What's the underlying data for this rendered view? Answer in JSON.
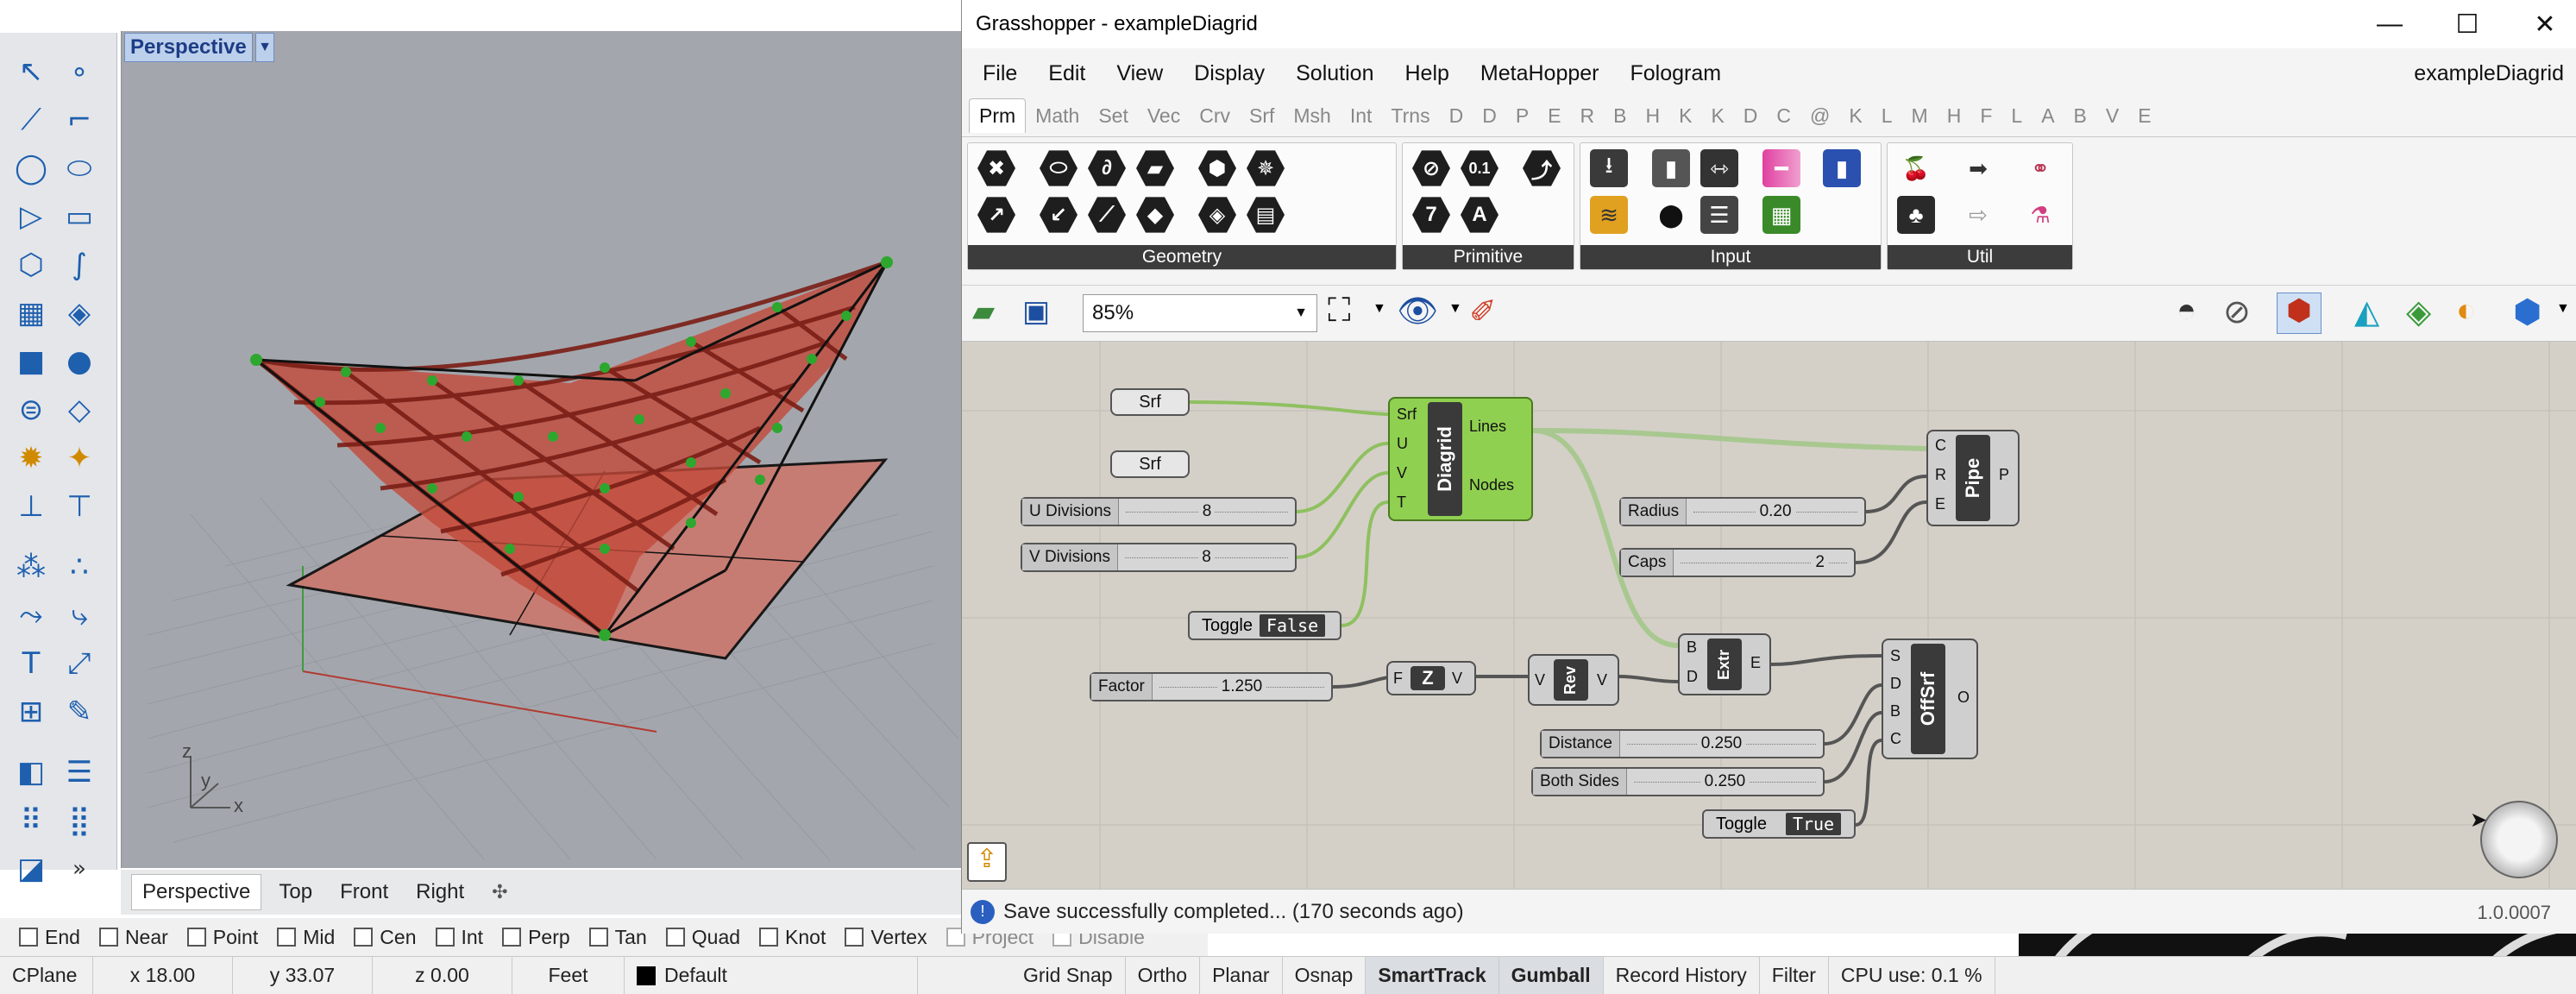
{
  "rhino": {
    "viewport_title": "Perspective",
    "axis_labels": {
      "z": "z",
      "y": "y",
      "x": "x"
    },
    "viewport_tabs": [
      "Perspective",
      "Top",
      "Front",
      "Right"
    ],
    "osnaps": [
      {
        "label": "End",
        "checked": false,
        "enabled": true
      },
      {
        "label": "Near",
        "checked": false,
        "enabled": true
      },
      {
        "label": "Point",
        "checked": false,
        "enabled": true
      },
      {
        "label": "Mid",
        "checked": false,
        "enabled": true
      },
      {
        "label": "Cen",
        "checked": false,
        "enabled": true
      },
      {
        "label": "Int",
        "checked": false,
        "enabled": true
      },
      {
        "label": "Perp",
        "checked": false,
        "enabled": true
      },
      {
        "label": "Tan",
        "checked": false,
        "enabled": true
      },
      {
        "label": "Quad",
        "checked": false,
        "enabled": true
      },
      {
        "label": "Knot",
        "checked": false,
        "enabled": true
      },
      {
        "label": "Vertex",
        "checked": false,
        "enabled": true
      },
      {
        "label": "Project",
        "checked": false,
        "enabled": false
      },
      {
        "label": "Disable",
        "checked": false,
        "enabled": false
      }
    ],
    "status": {
      "cplane": "CPlane",
      "x": "x 18.00",
      "y": "y 33.07",
      "z": "z 0.00",
      "units": "Feet",
      "layer": "Default",
      "toggles": [
        "Grid Snap",
        "Ortho",
        "Planar",
        "Osnap",
        "SmartTrack",
        "Gumball",
        "Record History",
        "Filter"
      ],
      "cpu": "CPU use: 0.1 %"
    }
  },
  "gh": {
    "title": "Grasshopper - exampleDiagrid",
    "menu": [
      "File",
      "Edit",
      "View",
      "Display",
      "Solution",
      "Help",
      "MetaHopper",
      "Fologram"
    ],
    "doc_name": "exampleDiagrid",
    "tabs": [
      "Prm",
      "Math",
      "Set",
      "Vec",
      "Crv",
      "Srf",
      "Msh",
      "Int",
      "Trns",
      "D",
      "D",
      "P",
      "E",
      "R",
      "B",
      "H",
      "K",
      "K",
      "D",
      "C",
      "@",
      "K",
      "L",
      "M",
      "H",
      "F",
      "L",
      "A",
      "B",
      "V",
      "E"
    ],
    "ribbon_groups": [
      "Geometry",
      "Primitive",
      "Input",
      "Util"
    ],
    "zoom": "85%",
    "status": "Save successfully completed... (170 seconds ago)",
    "version": "1.0.0007",
    "nodes": {
      "srf1": "Srf",
      "srf2": "Srf",
      "udiv": {
        "label": "U Divisions",
        "value": "8"
      },
      "vdiv": {
        "label": "V Divisions",
        "value": "8"
      },
      "toggle1": {
        "label": "Toggle",
        "value": "False"
      },
      "factor": {
        "label": "Factor",
        "value": "1.250"
      },
      "diagrid": {
        "name": "Diagrid",
        "inputs": [
          "Srf",
          "U",
          "V",
          "T"
        ],
        "outputs": [
          "Lines",
          "Nodes"
        ]
      },
      "radius": {
        "label": "Radius",
        "value": "0.20"
      },
      "caps": {
        "label": "Caps",
        "value": "2"
      },
      "pipe": {
        "name": "Pipe",
        "inputs": [
          "C",
          "R",
          "E"
        ],
        "output": "P"
      },
      "unitz": {
        "name": "Z",
        "input": "F",
        "output": "V"
      },
      "rev": {
        "name": "Rev",
        "input": "V",
        "output": "V"
      },
      "extr": {
        "name": "Extr",
        "inputs": [
          "B",
          "D"
        ],
        "output": "E"
      },
      "offsrf": {
        "name": "OffSrf",
        "inputs": [
          "S",
          "D",
          "B",
          "C"
        ],
        "output": "O"
      },
      "distance": {
        "label": "Distance",
        "value": "0.250"
      },
      "bothsides": {
        "label": "Both Sides",
        "value": "0.250"
      },
      "toggle2": {
        "label": "Toggle",
        "value": "True"
      }
    }
  }
}
